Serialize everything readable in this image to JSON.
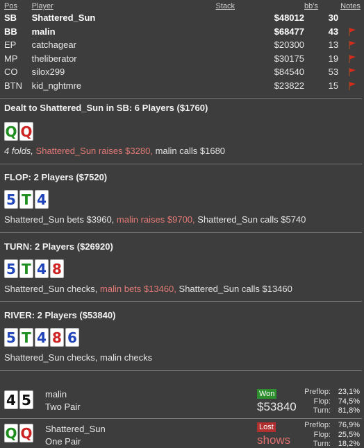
{
  "headers": {
    "pos": "Pos",
    "player": "Player",
    "stack": "Stack",
    "bb": "bb's",
    "notes": "Notes"
  },
  "players": [
    {
      "pos": "SB",
      "name": "Shattered_Sun",
      "stack": "$48012",
      "bb": "30",
      "bold": true,
      "flag": false
    },
    {
      "pos": "BB",
      "name": "malin",
      "stack": "$68477",
      "bb": "43",
      "bold": true,
      "flag": true
    },
    {
      "pos": "EP",
      "name": "catchagear",
      "stack": "$20300",
      "bb": "13",
      "bold": false,
      "flag": true
    },
    {
      "pos": "MP",
      "name": "theliberator",
      "stack": "$30175",
      "bb": "19",
      "bold": false,
      "flag": true
    },
    {
      "pos": "CO",
      "name": "silox299",
      "stack": "$84540",
      "bb": "53",
      "bold": false,
      "flag": true
    },
    {
      "pos": "BTN",
      "name": "kid_nghtmre",
      "stack": "$23822",
      "bb": "15",
      "bold": false,
      "flag": true
    }
  ],
  "preflop": {
    "title": "Dealt to Shattered_Sun in SB: 6 Players ($1760)",
    "cards": [
      {
        "rank": "Q",
        "color": "#1e8f1e"
      },
      {
        "rank": "Q",
        "color": "#cc2222"
      }
    ],
    "folds": "4 folds,",
    "raise": "Shattered_Sun raises $3280,",
    "rest": "malin calls $1680"
  },
  "flop": {
    "title": "FLOP: 2 Players ($7520)",
    "cards": [
      {
        "rank": "5",
        "color": "#1f43b8"
      },
      {
        "rank": "T",
        "color": "#1e8f1e"
      },
      {
        "rank": "4",
        "color": "#1f43b8"
      }
    ],
    "a1": "Shattered_Sun bets $3960,",
    "a2": "malin raises $9700,",
    "a3": "Shattered_Sun calls $5740"
  },
  "turn": {
    "title": "TURN: 2 Players ($26920)",
    "cards": [
      {
        "rank": "5",
        "color": "#1f43b8"
      },
      {
        "rank": "T",
        "color": "#1e8f1e"
      },
      {
        "rank": "4",
        "color": "#1f43b8"
      },
      {
        "rank": "8",
        "color": "#cc2222"
      }
    ],
    "a1": "Shattered_Sun checks,",
    "a2": "malin bets $13460,",
    "a3": "Shattered_Sun calls $13460"
  },
  "river": {
    "title": "RIVER: 2 Players ($53840)",
    "cards": [
      {
        "rank": "5",
        "color": "#1f43b8"
      },
      {
        "rank": "T",
        "color": "#1e8f1e"
      },
      {
        "rank": "4",
        "color": "#1f43b8"
      },
      {
        "rank": "8",
        "color": "#cc2222"
      },
      {
        "rank": "6",
        "color": "#1f43b8"
      }
    ],
    "a1": "Shattered_Sun checks, malin checks"
  },
  "results": [
    {
      "cards": [
        {
          "rank": "4",
          "color": "#111111"
        },
        {
          "rank": "5",
          "color": "#111111"
        }
      ],
      "name": "malin",
      "hand": "Two Pair",
      "badge": "Won",
      "amount": "$53840",
      "stats": [
        {
          "k": "Preflop:",
          "v": "23,1%"
        },
        {
          "k": "Flop:",
          "v": "74,5%"
        },
        {
          "k": "Turn:",
          "v": "81,8%"
        }
      ]
    },
    {
      "cards": [
        {
          "rank": "Q",
          "color": "#1e8f1e"
        },
        {
          "rank": "Q",
          "color": "#cc2222"
        }
      ],
      "name": "Shattered_Sun",
      "hand": "One Pair",
      "badge": "Lost",
      "amount": "shows",
      "stats": [
        {
          "k": "Preflop:",
          "v": "76,9%"
        },
        {
          "k": "Flop:",
          "v": "25,5%"
        },
        {
          "k": "Turn:",
          "v": "18,2%"
        }
      ]
    }
  ]
}
